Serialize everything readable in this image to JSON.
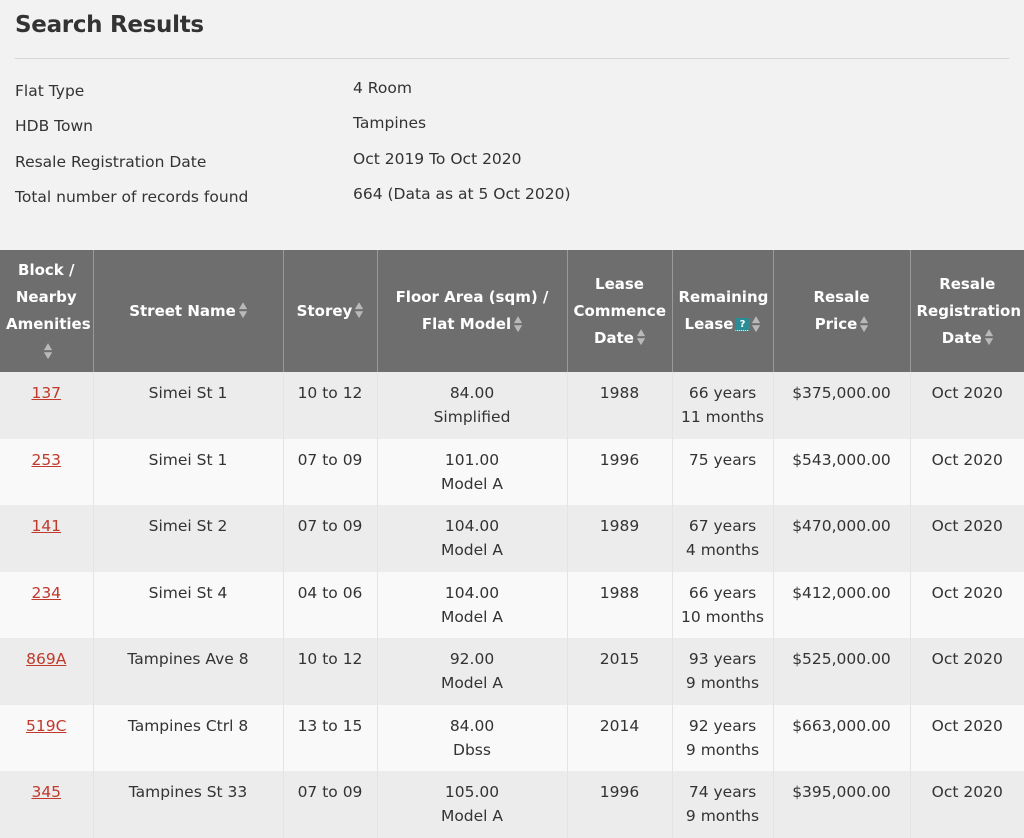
{
  "summary": {
    "title": "Search Results",
    "criteria": [
      {
        "label": "Flat Type",
        "value": "4 Room"
      },
      {
        "label": "HDB Town",
        "value": "Tampines"
      },
      {
        "label": "Resale Registration Date",
        "value": "Oct 2019 To Oct 2020"
      },
      {
        "label": "Total number of records found",
        "value": "664 (Data as at 5 Oct 2020)"
      }
    ]
  },
  "table": {
    "headers": {
      "block_l1": "Block /",
      "block_l2": "Nearby",
      "block_l3": "Amenities",
      "street": "Street Name",
      "storey": "Storey",
      "floor_l1": "Floor Area (sqm) /",
      "floor_l2": "Flat Model",
      "lease_l1": "Lease",
      "lease_l2": "Commence",
      "lease_l3": "Date",
      "remaining_l1": "Remaining",
      "remaining_l2": "Lease",
      "help": "?",
      "price_l1": "Resale",
      "price_l2": "Price",
      "reg_l1": "Resale",
      "reg_l2": "Registration",
      "reg_l3": "Date"
    },
    "rows": [
      {
        "block": "137",
        "street": "Simei St 1",
        "storey": "10 to 12",
        "area": "84.00",
        "model": "Simplified",
        "lease": "1988",
        "rem1": "66 years",
        "rem2": "11 months",
        "price": "$375,000.00",
        "reg": "Oct 2020"
      },
      {
        "block": "253",
        "street": "Simei St 1",
        "storey": "07 to 09",
        "area": "101.00",
        "model": "Model A",
        "lease": "1996",
        "rem1": "75 years",
        "rem2": "",
        "price": "$543,000.00",
        "reg": "Oct 2020"
      },
      {
        "block": "141",
        "street": "Simei St 2",
        "storey": "07 to 09",
        "area": "104.00",
        "model": "Model A",
        "lease": "1989",
        "rem1": "67 years",
        "rem2": "4 months",
        "price": "$470,000.00",
        "reg": "Oct 2020"
      },
      {
        "block": "234",
        "street": "Simei St 4",
        "storey": "04 to 06",
        "area": "104.00",
        "model": "Model A",
        "lease": "1988",
        "rem1": "66 years",
        "rem2": "10 months",
        "price": "$412,000.00",
        "reg": "Oct 2020"
      },
      {
        "block": "869A",
        "street": "Tampines Ave 8",
        "storey": "10 to 12",
        "area": "92.00",
        "model": "Model A",
        "lease": "2015",
        "rem1": "93 years",
        "rem2": "9 months",
        "price": "$525,000.00",
        "reg": "Oct 2020"
      },
      {
        "block": "519C",
        "street": "Tampines Ctrl 8",
        "storey": "13 to 15",
        "area": "84.00",
        "model": "Dbss",
        "lease": "2014",
        "rem1": "92 years",
        "rem2": "9 months",
        "price": "$663,000.00",
        "reg": "Oct 2020"
      },
      {
        "block": "345",
        "street": "Tampines St 33",
        "storey": "07 to 09",
        "area": "105.00",
        "model": "Model A",
        "lease": "1996",
        "rem1": "74 years",
        "rem2": "9 months",
        "price": "$395,000.00",
        "reg": "Oct 2020"
      }
    ]
  },
  "icons": {
    "sort": "sort-arrows-icon",
    "help": "help-icon"
  },
  "colors": {
    "header_bg": "#6e6e6e",
    "link": "#c0392b",
    "help_badge": "#2a8d96"
  }
}
